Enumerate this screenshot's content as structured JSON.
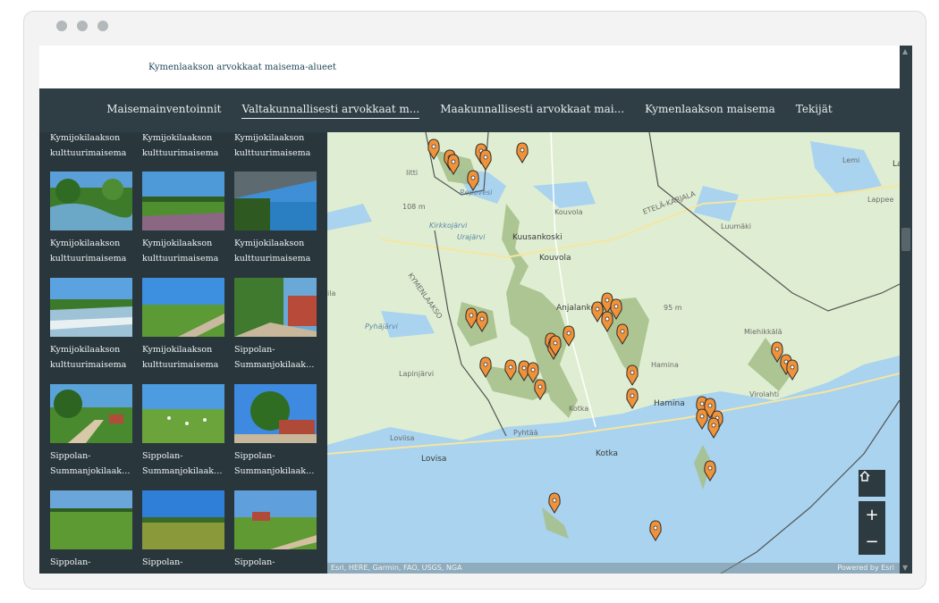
{
  "window": {
    "controls": [
      "dot",
      "dot",
      "dot"
    ]
  },
  "app": {
    "title": "Kymenlaakson arvokkaat maisema-alueet"
  },
  "nav": {
    "items": [
      {
        "label": "Maisemainventoinnit",
        "active": false
      },
      {
        "label": "Valtakunnallisesti arvokkaat m...",
        "active": true
      },
      {
        "label": "Maakunnallisesti arvokkaat mai...",
        "active": false
      },
      {
        "label": "Kymenlaakson maisema",
        "active": false
      },
      {
        "label": "Tekijät",
        "active": false
      }
    ]
  },
  "gallery": {
    "top_captions": [
      "Kymijokilaakson kulttuurimaisema",
      "Kymijokilaakson kulttuurimaisema",
      "Kymijokilaakson kulttuurimaisema"
    ],
    "cards": [
      {
        "line1": "Kymijokilaakson",
        "line2": "kulttuurimaisema"
      },
      {
        "line1": "Kymijokilaakson",
        "line2": "kulttuurimaisema"
      },
      {
        "line1": "Kymijokilaakson",
        "line2": "kulttuurimaisema"
      },
      {
        "line1": "Kymijokilaakson",
        "line2": "kulttuurimaisema"
      },
      {
        "line1": "Kymijokilaakson",
        "line2": "kulttuurimaisema"
      },
      {
        "line1": "Sippolan-",
        "line2": "Summanjokilaaksoje..."
      },
      {
        "line1": "Sippolan-",
        "line2": "Summanjokilaaksoje..."
      },
      {
        "line1": "Sippolan-",
        "line2": "Summanjokilaaksoje..."
      },
      {
        "line1": "Sippolan-",
        "line2": "Summanjokilaaksoje..."
      },
      {
        "line1": "Sippolan-",
        "line2": ""
      },
      {
        "line1": "Sippolan-",
        "line2": ""
      },
      {
        "line1": "Sippolan-",
        "line2": ""
      }
    ]
  },
  "map": {
    "labels": {
      "iitti": "Iitti",
      "kouvola": "Kouvola",
      "kuusankoski": "Kuusankoski",
      "anjalankoski": "Anjalankoski",
      "hamina": "Hamina",
      "kotka": "Kotka",
      "loviisa": "Loviisa",
      "lovisa": "Lovisa",
      "pyhtaa": "Pyhtää",
      "kotka2": "Kotka",
      "virolahti": "Virolahti",
      "miehikkala": "Miehikkälä",
      "luumaki": "Luumäki",
      "lemi": "Lemi",
      "lappee": "Lappee",
      "ila": "ila",
      "kymenlaakso": "KYMENLAAKSO",
      "etela_karjala": "ETELÄ-KARJALA",
      "lapinjarvi": "Lapinjärvi",
      "pyhajarvi": "Pyhäjärvi",
      "urajarvi": "Urajärvi",
      "kirkkojarvi": "Kirkkojärvi",
      "elimaki_m": "108 m",
      "m95": "95 m",
      "la": "La",
      "hamina_lbl": "Hamina"
    },
    "attribution": "Esri, HERE, Garmin, FAO, USGS, NGA",
    "powered_by": "Powered by Esri",
    "zoom_in": "+",
    "zoom_out": "−",
    "colors": {
      "marker": "#f0923a",
      "marker_stroke": "#2a2a2a",
      "area": "#a6c08c",
      "water": "#a9d3ee",
      "land": "#dfeed2"
    }
  }
}
